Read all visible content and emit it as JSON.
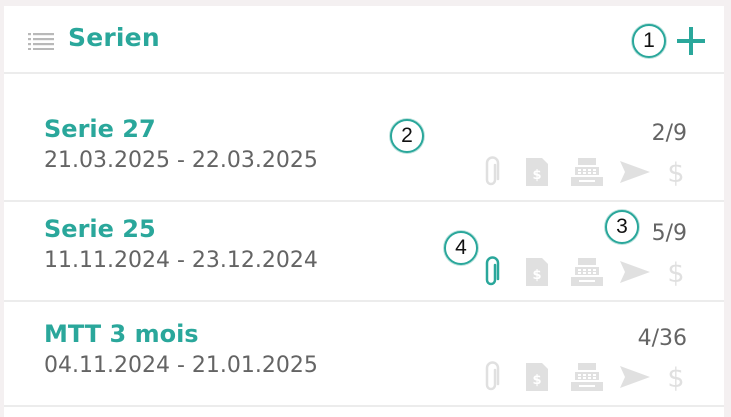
{
  "header": {
    "title": "Serien",
    "list_icon": "list-icon",
    "add_icon": "plus-icon"
  },
  "colors": {
    "accent": "#2aa79b",
    "text_secondary": "#646464",
    "icon_inactive": "#e0e0e0",
    "divider": "#ececec",
    "background": "#f4f0f1"
  },
  "series": [
    {
      "name": "Serie 27",
      "dates": "21.03.2025 - 22.03.2025",
      "count": "2/9",
      "attachment_active": false
    },
    {
      "name": "Serie 25",
      "dates": "11.11.2024 - 23.12.2024",
      "count": "5/9",
      "attachment_active": true
    },
    {
      "name": "MTT 3 mois",
      "dates": "04.11.2024 - 21.01.2025",
      "count": "4/36",
      "attachment_active": false
    }
  ],
  "row_actions": [
    "paperclip-icon",
    "invoice-icon",
    "cash-register-icon",
    "send-icon",
    "dollar-icon"
  ],
  "annotations": [
    "1",
    "2",
    "3",
    "4"
  ]
}
